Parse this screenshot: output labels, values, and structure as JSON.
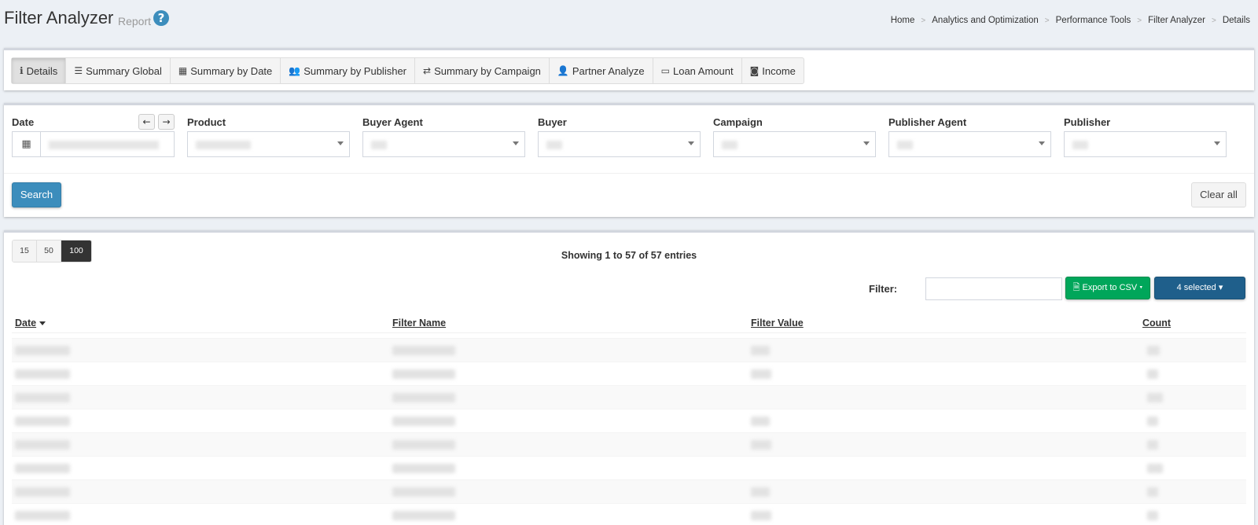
{
  "header": {
    "title": "Filter Analyzer",
    "subtitle": "Report",
    "help_glyph": "?",
    "breadcrumb": [
      "Home",
      "Analytics and Optimization",
      "Performance Tools",
      "Filter Analyzer",
      "Details"
    ]
  },
  "tabs": [
    {
      "label": "Details",
      "icon": "info-icon",
      "glyph": "ℹ",
      "active": true
    },
    {
      "label": "Summary Global",
      "icon": "list-icon",
      "glyph": "☰",
      "active": false
    },
    {
      "label": "Summary by Date",
      "icon": "calendar-icon",
      "glyph": "▦",
      "active": false
    },
    {
      "label": "Summary by Publisher",
      "icon": "users-icon",
      "glyph": "👥",
      "active": false
    },
    {
      "label": "Summary by Campaign",
      "icon": "random-icon",
      "glyph": "⇄",
      "active": false
    },
    {
      "label": "Partner Analyze",
      "icon": "user-icon",
      "glyph": "👤",
      "active": false
    },
    {
      "label": "Loan Amount",
      "icon": "credit-card-icon",
      "glyph": "▭",
      "active": false
    },
    {
      "label": "Income",
      "icon": "money-icon",
      "glyph": "◙",
      "active": false
    }
  ],
  "filters": {
    "date_label": "Date",
    "date_icon_glyph": "▦",
    "prev_glyph": "←",
    "next_glyph": "→",
    "fields": [
      {
        "key": "product",
        "label": "Product"
      },
      {
        "key": "buyer_agent",
        "label": "Buyer Agent"
      },
      {
        "key": "buyer",
        "label": "Buyer"
      },
      {
        "key": "campaign",
        "label": "Campaign"
      },
      {
        "key": "publisher_agent",
        "label": "Publisher Agent"
      },
      {
        "key": "publisher",
        "label": "Publisher"
      }
    ],
    "search_label": "Search",
    "clear_label": "Clear all"
  },
  "table": {
    "page_sizes": [
      "15",
      "50",
      "100"
    ],
    "active_page_size": "100",
    "entries_text": "Showing 1 to 57 of 57 entries",
    "filter_label": "Filter:",
    "export_label": "Export to CSV",
    "export_icon_glyph": "🗎",
    "selected_label": "4 selected",
    "columns": [
      "Date",
      "Filter Name",
      "Filter Value",
      "Count"
    ],
    "sorted_column": "Date",
    "visible_rows": 8
  },
  "colors": {
    "primary": "#3c8dbc",
    "success": "#00a65a",
    "selected_button": "#1f5f8b",
    "background": "#ecf0f5"
  }
}
